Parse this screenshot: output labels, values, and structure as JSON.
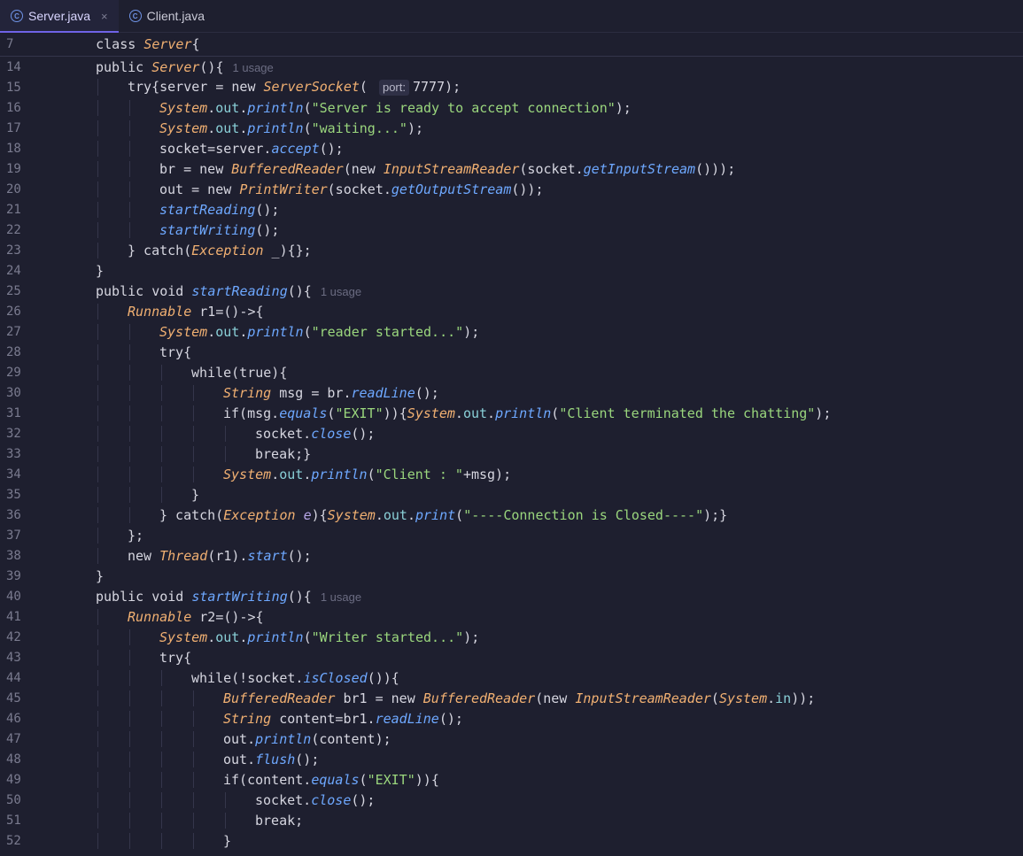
{
  "tabs": [
    {
      "label": "Server.java",
      "active": true,
      "close": "×"
    },
    {
      "label": "Client.java",
      "active": false
    }
  ],
  "sticky": {
    "num": "7",
    "kw": "class ",
    "name": "Server",
    "brace": "{"
  },
  "hints": {
    "usage": "1 usage",
    "port": "port:"
  },
  "lines": [
    {
      "n": "14",
      "i": 1,
      "t": [
        [
          "kw",
          "public "
        ],
        [
          "cls",
          "Server"
        ],
        [
          "kw",
          "(){"
        ],
        [
          "hint",
          "1 usage"
        ]
      ]
    },
    {
      "n": "15",
      "i": 2,
      "t": [
        [
          "kw",
          "try{server = new "
        ],
        [
          "cls",
          "ServerSocket"
        ],
        [
          "kw",
          "( "
        ],
        [
          "phint",
          "port:"
        ],
        [
          "kw",
          "7777);"
        ]
      ]
    },
    {
      "n": "16",
      "i": 3,
      "t": [
        [
          "cls",
          "System"
        ],
        [
          "kw",
          "."
        ],
        [
          "fld",
          "out"
        ],
        [
          "kw",
          "."
        ],
        [
          "mth",
          "println"
        ],
        [
          "kw",
          "("
        ],
        [
          "str",
          "\"Server is ready to accept connection\""
        ],
        [
          "kw",
          ");"
        ]
      ]
    },
    {
      "n": "17",
      "i": 3,
      "t": [
        [
          "cls",
          "System"
        ],
        [
          "kw",
          "."
        ],
        [
          "fld",
          "out"
        ],
        [
          "kw",
          "."
        ],
        [
          "mth",
          "println"
        ],
        [
          "kw",
          "("
        ],
        [
          "str",
          "\"waiting...\""
        ],
        [
          "kw",
          ");"
        ]
      ]
    },
    {
      "n": "18",
      "i": 3,
      "t": [
        [
          "kw",
          "socket=server."
        ],
        [
          "mth",
          "accept"
        ],
        [
          "kw",
          "();"
        ]
      ]
    },
    {
      "n": "19",
      "i": 3,
      "t": [
        [
          "kw",
          "br = new "
        ],
        [
          "cls",
          "BufferedReader"
        ],
        [
          "kw",
          "(new "
        ],
        [
          "cls",
          "InputStreamReader"
        ],
        [
          "kw",
          "(socket."
        ],
        [
          "mth",
          "getInputStream"
        ],
        [
          "kw",
          "()));"
        ]
      ]
    },
    {
      "n": "20",
      "i": 3,
      "t": [
        [
          "kw",
          "out = new "
        ],
        [
          "cls",
          "PrintWriter"
        ],
        [
          "kw",
          "(socket."
        ],
        [
          "mth",
          "getOutputStream"
        ],
        [
          "kw",
          "());"
        ]
      ]
    },
    {
      "n": "21",
      "i": 3,
      "t": [
        [
          "mth",
          "startReading"
        ],
        [
          "kw",
          "();"
        ]
      ]
    },
    {
      "n": "22",
      "i": 3,
      "t": [
        [
          "mth",
          "startWriting"
        ],
        [
          "kw",
          "();"
        ]
      ]
    },
    {
      "n": "23",
      "i": 2,
      "t": [
        [
          "kw",
          "} catch("
        ],
        [
          "cls",
          "Exception"
        ],
        [
          "kw",
          " _){};"
        ]
      ]
    },
    {
      "n": "24",
      "i": 1,
      "t": [
        [
          "kw",
          "}"
        ]
      ]
    },
    {
      "n": "25",
      "i": 1,
      "t": [
        [
          "kw",
          "public void "
        ],
        [
          "mth",
          "startReading"
        ],
        [
          "kw",
          "(){"
        ],
        [
          "hint",
          "1 usage"
        ]
      ]
    },
    {
      "n": "26",
      "i": 2,
      "t": [
        [
          "cls",
          "Runnable"
        ],
        [
          "kw",
          " r1=()->{"
        ]
      ]
    },
    {
      "n": "27",
      "i": 3,
      "t": [
        [
          "cls",
          "System"
        ],
        [
          "kw",
          "."
        ],
        [
          "fld",
          "out"
        ],
        [
          "kw",
          "."
        ],
        [
          "mth",
          "println"
        ],
        [
          "kw",
          "("
        ],
        [
          "str",
          "\"reader started...\""
        ],
        [
          "kw",
          ");"
        ]
      ]
    },
    {
      "n": "28",
      "i": 3,
      "t": [
        [
          "kw",
          "try{"
        ]
      ]
    },
    {
      "n": "29",
      "i": 4,
      "t": [
        [
          "kw",
          "while(true){"
        ]
      ]
    },
    {
      "n": "30",
      "i": 5,
      "t": [
        [
          "cls",
          "String"
        ],
        [
          "kw",
          " msg = br."
        ],
        [
          "mth",
          "readLine"
        ],
        [
          "kw",
          "();"
        ]
      ]
    },
    {
      "n": "31",
      "i": 5,
      "t": [
        [
          "kw",
          "if(msg."
        ],
        [
          "mth",
          "equals"
        ],
        [
          "kw",
          "("
        ],
        [
          "str",
          "\"EXIT\""
        ],
        [
          "kw",
          "))"
        ],
        [
          "kw",
          "{"
        ],
        [
          "cls",
          "System"
        ],
        [
          "kw",
          "."
        ],
        [
          "fld",
          "out"
        ],
        [
          "kw",
          "."
        ],
        [
          "mth",
          "println"
        ],
        [
          "kw",
          "("
        ],
        [
          "str",
          "\"Client terminated the chatting\""
        ],
        [
          "kw",
          ");"
        ]
      ]
    },
    {
      "n": "32",
      "i": 6,
      "t": [
        [
          "kw",
          "socket."
        ],
        [
          "mth",
          "close"
        ],
        [
          "kw",
          "();"
        ]
      ]
    },
    {
      "n": "33",
      "i": 6,
      "t": [
        [
          "kw",
          "break;}"
        ]
      ]
    },
    {
      "n": "34",
      "i": 5,
      "t": [
        [
          "cls",
          "System"
        ],
        [
          "kw",
          "."
        ],
        [
          "fld",
          "out"
        ],
        [
          "kw",
          "."
        ],
        [
          "mth",
          "println"
        ],
        [
          "kw",
          "("
        ],
        [
          "str",
          "\"Client : \""
        ],
        [
          "kw",
          "+msg);"
        ]
      ]
    },
    {
      "n": "35",
      "i": 4,
      "t": [
        [
          "kw",
          "}"
        ]
      ]
    },
    {
      "n": "36",
      "i": 3,
      "t": [
        [
          "kw",
          "} catch("
        ],
        [
          "cls",
          "Exception"
        ],
        [
          "kw",
          " "
        ],
        [
          "param",
          "e"
        ],
        [
          "kw",
          "){"
        ],
        [
          "cls",
          "System"
        ],
        [
          "kw",
          "."
        ],
        [
          "fld",
          "out"
        ],
        [
          "kw",
          "."
        ],
        [
          "mth",
          "print"
        ],
        [
          "kw",
          "("
        ],
        [
          "str",
          "\"----Connection is Closed----\""
        ],
        [
          "kw",
          ");}"
        ]
      ]
    },
    {
      "n": "37",
      "i": 2,
      "t": [
        [
          "kw",
          "};"
        ]
      ]
    },
    {
      "n": "38",
      "i": 2,
      "t": [
        [
          "kw",
          "new "
        ],
        [
          "cls",
          "Thread"
        ],
        [
          "kw",
          "(r1)."
        ],
        [
          "mth",
          "start"
        ],
        [
          "kw",
          "();"
        ]
      ]
    },
    {
      "n": "39",
      "i": 1,
      "t": [
        [
          "kw",
          "}"
        ]
      ]
    },
    {
      "n": "40",
      "i": 1,
      "t": [
        [
          "kw",
          "public void "
        ],
        [
          "mth",
          "startWriting"
        ],
        [
          "kw",
          "(){"
        ],
        [
          "hint",
          "1 usage"
        ]
      ]
    },
    {
      "n": "41",
      "i": 2,
      "t": [
        [
          "cls",
          "Runnable"
        ],
        [
          "kw",
          " r2=()->{"
        ]
      ]
    },
    {
      "n": "42",
      "i": 3,
      "t": [
        [
          "cls",
          "System"
        ],
        [
          "kw",
          "."
        ],
        [
          "fld",
          "out"
        ],
        [
          "kw",
          "."
        ],
        [
          "mth",
          "println"
        ],
        [
          "kw",
          "("
        ],
        [
          "str",
          "\"Writer started...\""
        ],
        [
          "kw",
          ");"
        ]
      ]
    },
    {
      "n": "43",
      "i": 3,
      "t": [
        [
          "kw",
          "try{"
        ]
      ]
    },
    {
      "n": "44",
      "i": 4,
      "t": [
        [
          "kw",
          "while(!socket."
        ],
        [
          "mth",
          "isClosed"
        ],
        [
          "kw",
          "()){"
        ]
      ]
    },
    {
      "n": "45",
      "i": 5,
      "t": [
        [
          "cls",
          "BufferedReader"
        ],
        [
          "kw",
          " br1 = new "
        ],
        [
          "cls",
          "BufferedReader"
        ],
        [
          "kw",
          "(new "
        ],
        [
          "cls",
          "InputStreamReader"
        ],
        [
          "kw",
          "("
        ],
        [
          "cls",
          "System"
        ],
        [
          "kw",
          "."
        ],
        [
          "fld",
          "in"
        ],
        [
          "kw",
          "));"
        ]
      ]
    },
    {
      "n": "46",
      "i": 5,
      "t": [
        [
          "cls",
          "String"
        ],
        [
          "kw",
          " content=br1."
        ],
        [
          "mth",
          "readLine"
        ],
        [
          "kw",
          "();"
        ]
      ]
    },
    {
      "n": "47",
      "i": 5,
      "t": [
        [
          "kw",
          "out."
        ],
        [
          "mth",
          "println"
        ],
        [
          "kw",
          "(content);"
        ]
      ]
    },
    {
      "n": "48",
      "i": 5,
      "t": [
        [
          "kw",
          "out."
        ],
        [
          "mth",
          "flush"
        ],
        [
          "kw",
          "();"
        ]
      ]
    },
    {
      "n": "49",
      "i": 5,
      "t": [
        [
          "kw",
          "if(content."
        ],
        [
          "mth",
          "equals"
        ],
        [
          "kw",
          "("
        ],
        [
          "str",
          "\"EXIT\""
        ],
        [
          "kw",
          "))"
        ],
        [
          "kw",
          "{"
        ]
      ]
    },
    {
      "n": "50",
      "i": 6,
      "t": [
        [
          "kw",
          "socket."
        ],
        [
          "mth",
          "close"
        ],
        [
          "kw",
          "();"
        ]
      ]
    },
    {
      "n": "51",
      "i": 6,
      "t": [
        [
          "kw",
          "break;"
        ]
      ]
    },
    {
      "n": "52",
      "i": 5,
      "t": [
        [
          "kw",
          "}"
        ]
      ]
    }
  ]
}
